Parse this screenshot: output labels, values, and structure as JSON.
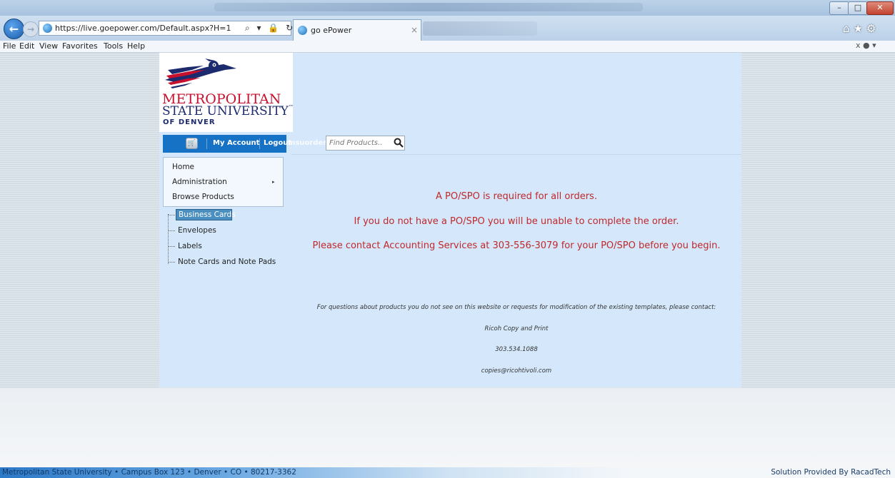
{
  "browser": {
    "address_url": "https://live.goepower.com/Default.aspx?H=1",
    "address_controls": "⌕ ▾ 🔒 ↻",
    "tab_title": "go ePower",
    "tab_close": "×",
    "window_buttons": {
      "minimize": "–",
      "maximize": "□",
      "close": "✕"
    },
    "right_icons": "⌂★⚙",
    "menu": [
      "File",
      "Edit",
      "View",
      "Favorites",
      "Tools",
      "Help"
    ],
    "menu_right": "x ● ▾"
  },
  "logo": {
    "line1": "METROPOLITAN",
    "line2": "STATE UNIVERSITY",
    "tm": "™",
    "line3": "OF DENVER"
  },
  "toolbar": {
    "my_account": "My Account",
    "logout": "Logout",
    "ghost_text": "msuorder"
  },
  "search": {
    "placeholder": "Find Products.."
  },
  "dropdown": {
    "items": [
      "Home",
      "Administration",
      "Browse Products"
    ],
    "submenu_arrow": "▸"
  },
  "tree": {
    "items": [
      "Business Cards",
      "Envelopes",
      "Labels",
      "Note Cards and Note Pads"
    ]
  },
  "notices": [
    "A PO/SPO is required for all orders.",
    "If you do not have a PO/SPO you will be unable to complete the order.",
    "Please contact Accounting Services at 303-556-3079 for your PO/SPO before you begin."
  ],
  "contact": {
    "intro": "For questions about products you do not see on this website or requests for modification of the existing templates, please contact:",
    "name": "Ricoh Copy and Print",
    "phone": "303.534.1088",
    "email": "copies@ricohtivoli.com"
  },
  "footer": {
    "address": "Metropolitan State University • Campus Box 123 • Denver • CO • 80217-3362",
    "credit": "Solution Provided By RacadTech"
  },
  "colors": {
    "accent_blue": "#1572c4",
    "notice_red": "#c0282a",
    "logo_red": "#c6102e",
    "logo_navy": "#1c2a6e",
    "content_bg": "#d5e8fb"
  }
}
